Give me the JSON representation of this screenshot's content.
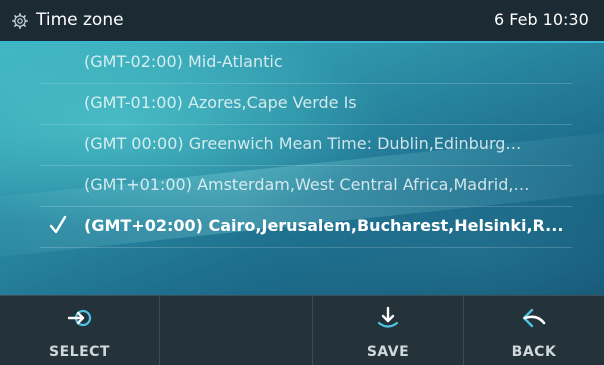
{
  "header": {
    "icon": "gear-icon",
    "title": "Time zone",
    "datetime": "6 Feb 10:30",
    "accent_color": "#39b6cf"
  },
  "timezone_list": {
    "items": [
      {
        "label": "(GMT-02:00) Mid-Atlantic",
        "selected": false
      },
      {
        "label": "(GMT-01:00) Azores,Cape Verde Is",
        "selected": false
      },
      {
        "label": "(GMT 00:00) Greenwich Mean Time: Dublin,Edinburg…",
        "selected": false
      },
      {
        "label": "(GMT+01:00) Amsterdam,West Central Africa,Madrid,…",
        "selected": false
      },
      {
        "label": "(GMT+02:00) Cairo,Jerusalem,Bucharest,Helsinki,R...",
        "selected": true,
        "icon": "checkmark-icon"
      }
    ]
  },
  "softkeys": [
    {
      "label": "SELECT",
      "icon": "select-arrow-icon"
    },
    {
      "label": "",
      "icon": ""
    },
    {
      "label": "SAVE",
      "icon": "save-download-icon"
    },
    {
      "label": "BACK",
      "icon": "back-arrow-icon"
    }
  ]
}
